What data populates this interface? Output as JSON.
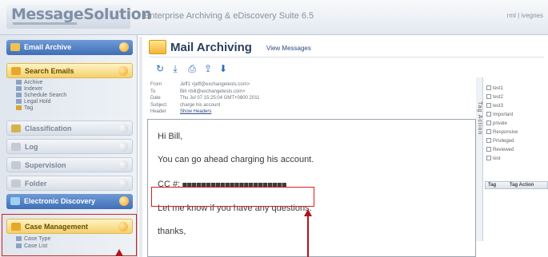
{
  "header": {
    "logo": "MessageSolution",
    "suite_title": "Enterprise Archiving & eDiscovery Suite 6.5",
    "links": "rml | ivegnes"
  },
  "sidebar": {
    "email_archive": "Email Archive",
    "search_emails": "Search Emails",
    "search_items": [
      "Archive",
      "Indexer",
      "Schedule Search",
      "Legal Hold",
      "Tag"
    ],
    "classification": "Classification",
    "log": "Log",
    "supervision": "Supervision",
    "folder": "Folder",
    "electronic_discovery": "Electronic Discovery",
    "case_management": "Case Management",
    "case_items": [
      "Case Type",
      "Case List"
    ]
  },
  "main": {
    "title": "Mail Archiving",
    "view_messages": "View Messages",
    "toolbar_icons": [
      "refresh-icon",
      "download-icon",
      "print-icon",
      "export-icon",
      "move-down-icon"
    ]
  },
  "message": {
    "from_label": "From",
    "from_value": "Jeff1 <jeff@exchangetests.com>",
    "to_label": "To",
    "to_value": "Bill <bill@exchangetests.com>",
    "date_label": "Date",
    "date_value": "Thu Jul 07 15:25:04 GMT+0800 2011",
    "subject_label": "Subject",
    "subject_value": "charge his account",
    "header_label": "Header",
    "header_link": "Show Headers",
    "greeting": "Hi Bill,",
    "line1": "You can go ahead charging his account.",
    "cc_label": "CC #:",
    "cc_value": "■■■■■■■■■■■■■■■■■■■■■■",
    "line3": "Let me know if you have any questions.",
    "signoff": "thanks,"
  },
  "tags": {
    "vertical_label": "Tag Action",
    "items": [
      "test1",
      "test2",
      "test3",
      "Important",
      "private",
      "Responsive",
      "Privileged",
      "Reviewed",
      "test"
    ],
    "col_tag": "Tag",
    "col_action": "Tag Action"
  },
  "colors": {
    "annotation_red": "#d61e1e",
    "arrow": "#b2141c",
    "nav_blue": "#3f6fb6",
    "nav_gold": "#f4d06f"
  }
}
